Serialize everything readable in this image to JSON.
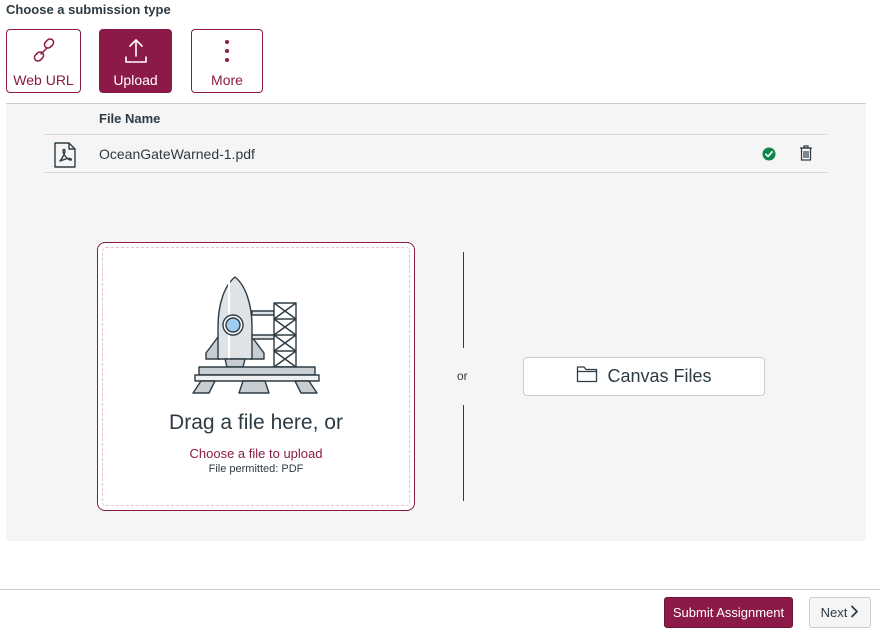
{
  "heading": "Choose a submission type",
  "submission_types": [
    {
      "label": "Web URL",
      "icon": "link-icon"
    },
    {
      "label": "Upload",
      "icon": "upload-icon",
      "active": true
    },
    {
      "label": "More",
      "icon": "more-vertical-icon"
    }
  ],
  "file_list": {
    "header": "File Name",
    "files": [
      {
        "name": "OceanGateWarned-1.pdf",
        "icon": "pdf-file-icon",
        "status": "success",
        "status_icon": "check-circle-icon",
        "action_icon": "trash-icon"
      }
    ]
  },
  "dropzone": {
    "title": "Drag a file here, or",
    "link": "Choose a file to upload",
    "note": "File permitted: PDF",
    "illustration": "rocket-launch-icon"
  },
  "or_label": "or",
  "canvas_files": {
    "label": "Canvas Files",
    "icon": "folder-icon"
  },
  "footer": {
    "submit_label": "Submit Assignment",
    "next_label": "Next",
    "next_icon": "chevron-right-icon"
  },
  "colors": {
    "accent": "#8b1a48",
    "success": "#0b874b",
    "text": "#2d3b45",
    "panel_bg": "#f5f5f5"
  }
}
